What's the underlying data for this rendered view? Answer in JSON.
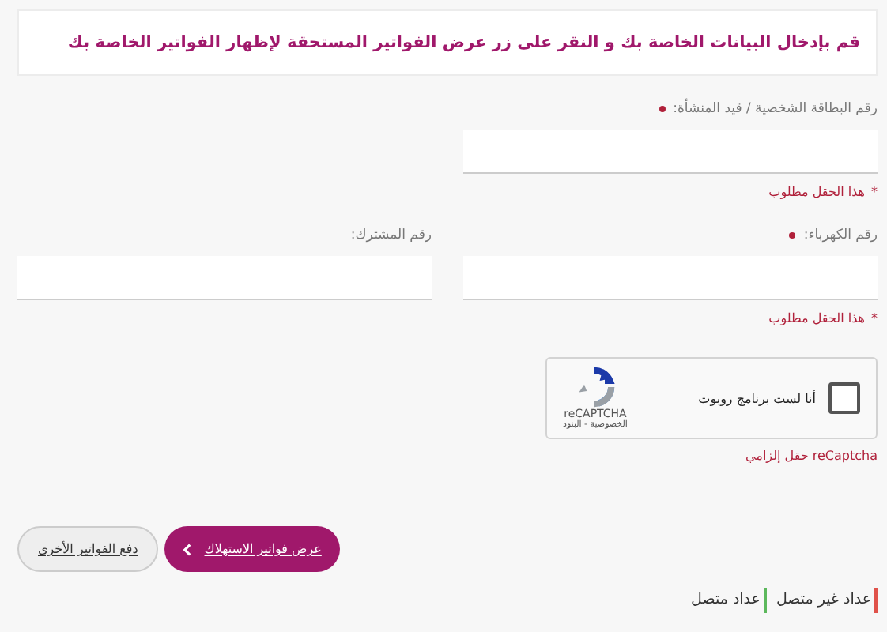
{
  "header": {
    "title": "قم بإدخال البيانات الخاصة بك و النقر على زر عرض الفواتير المستحقة لإظهار الفواتير الخاصة بك"
  },
  "field_rows": [
    {
      "fields": [
        {
          "label": "رقم البطاقة الشخصية / قيد المنشأة:",
          "required": true,
          "error_mark": "*",
          "error": "هذا الحقل مطلوب"
        }
      ]
    },
    {
      "fields": [
        {
          "label": "رقم الكهرباء:",
          "required": true,
          "error_mark": "*",
          "error": "هذا الحقل مطلوب"
        },
        {
          "label": "رقم المشترك:",
          "required": false
        }
      ]
    }
  ],
  "captcha": {
    "checked": false,
    "label": "أنا لست برنامج روبوت",
    "brand": "reCAPTCHA",
    "links": "الخصوصية - البنود",
    "error": "reCaptcha حقل إلزامي"
  },
  "buttons": [
    {
      "label": "عرض فواتير الاستهلاك",
      "kind": "primary"
    },
    {
      "label": "دفع الفواتير الأخرى",
      "kind": "secondary"
    }
  ],
  "legend": [
    {
      "label": "عداد غير متصل",
      "color": "#e0524a"
    },
    {
      "label": "عداد متصل",
      "color": "#5cb85c"
    }
  ]
}
